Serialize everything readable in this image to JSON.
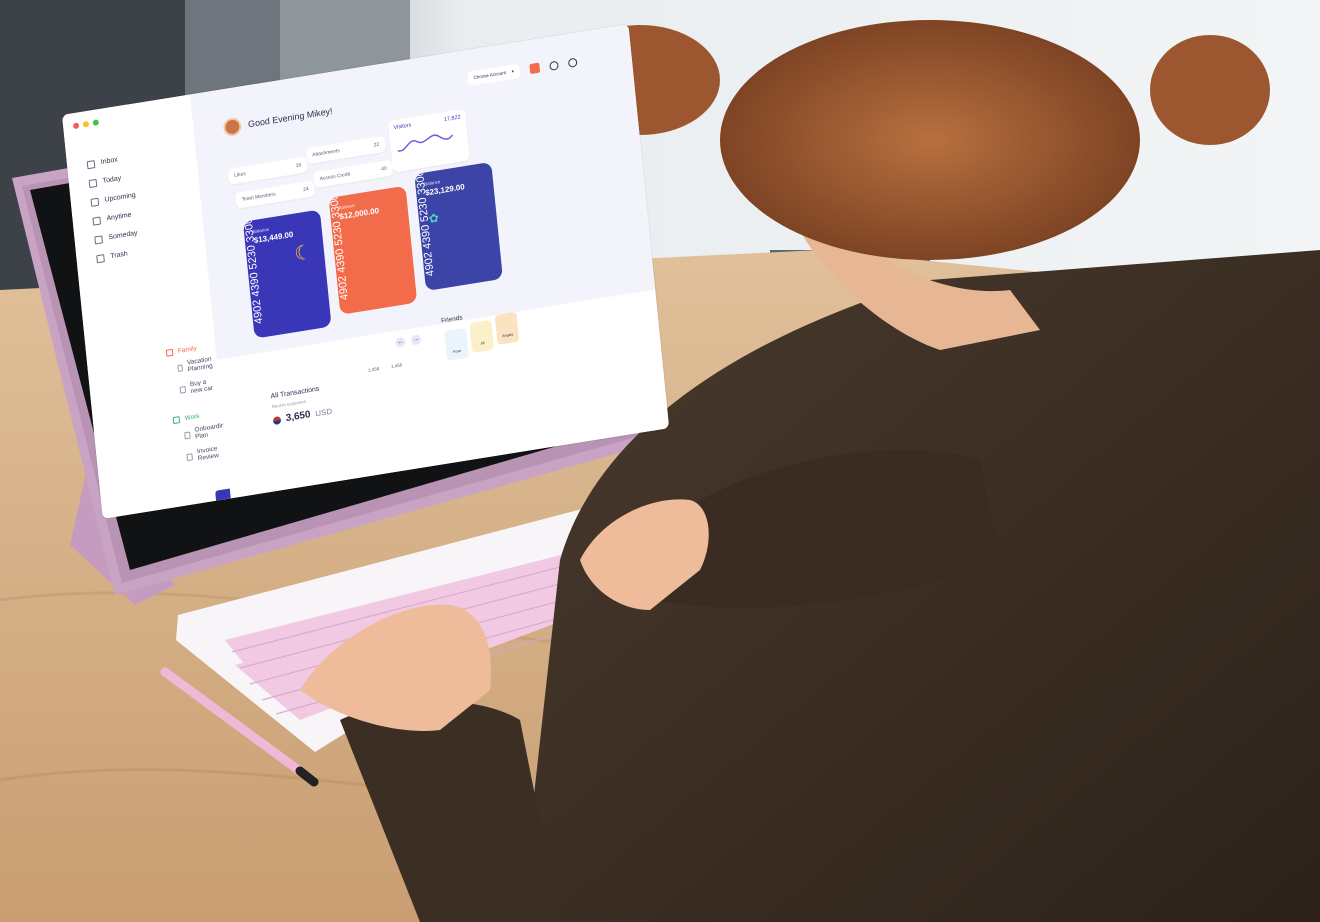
{
  "tablet_app": {
    "greeting": "Good Evening Mikey!",
    "account_select": "Choose Account",
    "sidebar": {
      "nav_items": [
        "Inbox",
        "Today",
        "Upcoming",
        "Anytime",
        "Someday",
        "Trash"
      ],
      "groups": [
        {
          "name": "Family",
          "color": "#f26b4a",
          "items": [
            "Vacation Planning",
            "Buy a new car"
          ]
        },
        {
          "name": "Work",
          "color": "#3ab37a",
          "items": [
            "Onboarding Plan",
            "Invoice Review"
          ]
        }
      ]
    },
    "stat_chips": [
      {
        "label": "Likes",
        "value": "16"
      },
      {
        "label": "Attachments",
        "value": "22"
      },
      {
        "label": "Team Members",
        "value": "24"
      },
      {
        "label": "Access Credit",
        "value": "40"
      }
    ],
    "visitors": {
      "label": "Visitors",
      "value": "17,822"
    },
    "cards": [
      {
        "balance_label": "Balance",
        "amount": "$13,449.00",
        "number": "4902 4390 5230 3300",
        "color": "#3a36b8"
      },
      {
        "balance_label": "Balance",
        "amount": "$12,000.00",
        "number": "4902 4390 5230 3300",
        "color": "#f26b4a"
      },
      {
        "balance_label": "Balance",
        "amount": "$23,129.00",
        "number": "4902 4390 5230 3300",
        "color": "#3c44a8"
      }
    ],
    "transactions": {
      "title": "All Transactions",
      "subtitle": "Recent expenses",
      "amount": "3,650",
      "currency": "USD",
      "mini_values": [
        "1,456",
        "1,456"
      ]
    },
    "friends": {
      "title": "Friends",
      "names": [
        "Rose",
        "Jill",
        "Angela"
      ]
    }
  },
  "colors": {
    "tablet_case": "#c9a3c4",
    "keyboard_keys": "#f1c9e3",
    "jacket": "#3f3025",
    "hair": "#9e5a35",
    "desk": "#d8b48c"
  }
}
